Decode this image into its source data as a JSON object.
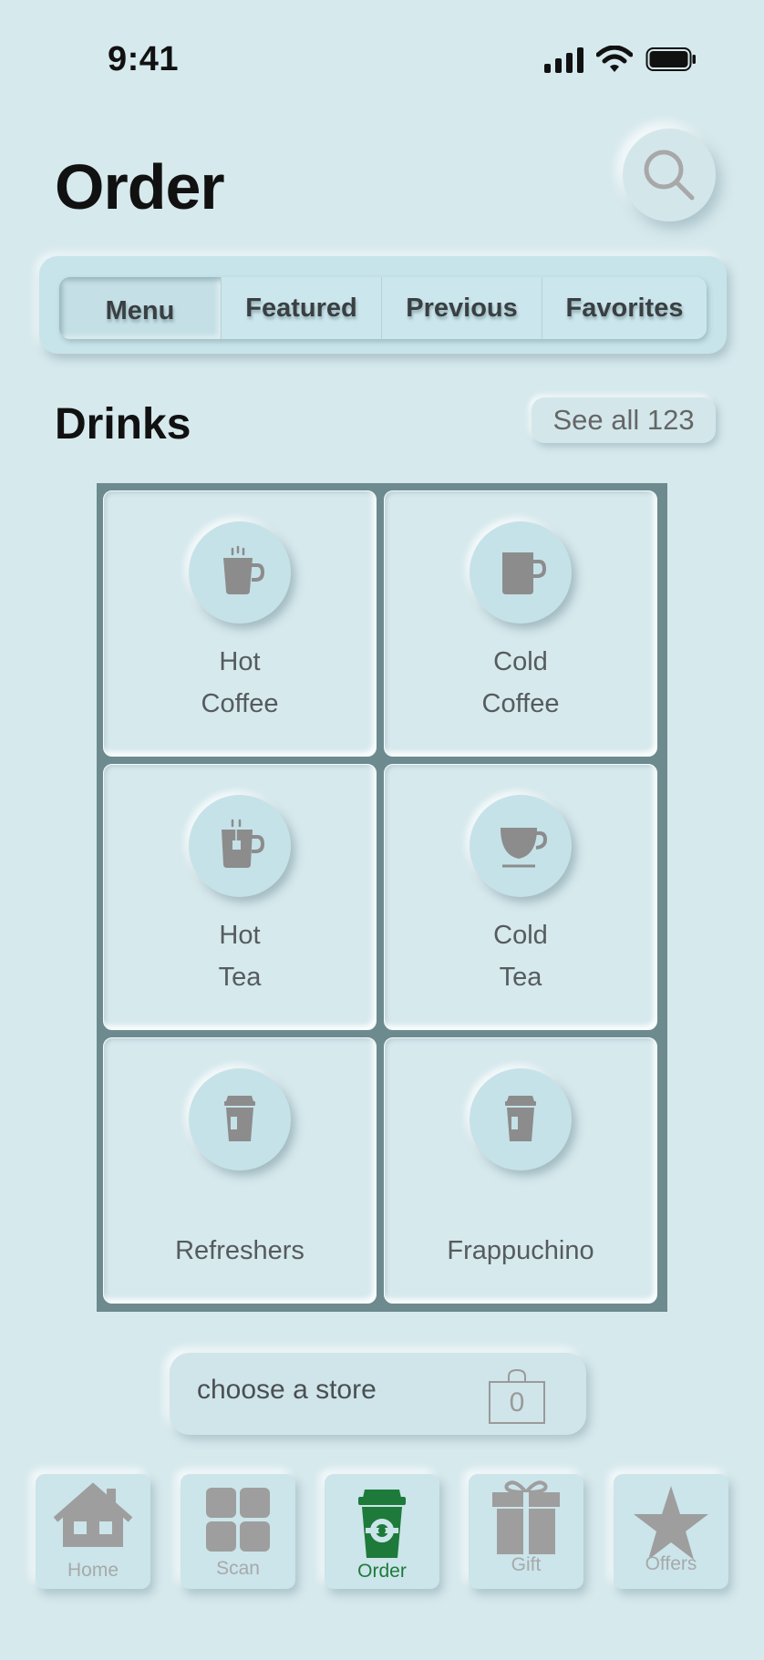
{
  "status": {
    "time": "9:41"
  },
  "header": {
    "title": "Order"
  },
  "tabs": [
    {
      "label": "Menu",
      "active": true
    },
    {
      "label": "Featured",
      "active": false
    },
    {
      "label": "Previous",
      "active": false
    },
    {
      "label": "Favorites",
      "active": false
    }
  ],
  "section": {
    "title": "Drinks",
    "see_all": "See all 123"
  },
  "categories": [
    {
      "line1": "Hot",
      "line2": "Coffee",
      "icon": "hot-coffee-icon"
    },
    {
      "line1": "Cold",
      "line2": "Coffee",
      "icon": "cold-coffee-icon"
    },
    {
      "line1": "Hot",
      "line2": "Tea",
      "icon": "hot-tea-icon"
    },
    {
      "line1": "Cold",
      "line2": "Tea",
      "icon": "cold-tea-icon"
    },
    {
      "line1": "Refreshers",
      "line2": "",
      "icon": "cup-icon"
    },
    {
      "line1": "Frappuchino",
      "line2": "",
      "icon": "cup-icon"
    }
  ],
  "store": {
    "label": "choose a store",
    "bag_count": "0"
  },
  "nav": [
    {
      "label": "Home",
      "icon": "home-icon",
      "active": false
    },
    {
      "label": "Scan",
      "icon": "scan-icon",
      "active": false
    },
    {
      "label": "Order",
      "icon": "order-cup-icon",
      "active": true
    },
    {
      "label": "Gift",
      "icon": "gift-icon",
      "active": false
    },
    {
      "label": "Offers",
      "icon": "star-icon",
      "active": false
    }
  ],
  "colors": {
    "background": "#d6e9ed",
    "accent": "#1e7a3a",
    "grid_frame": "#6d8a8e"
  }
}
